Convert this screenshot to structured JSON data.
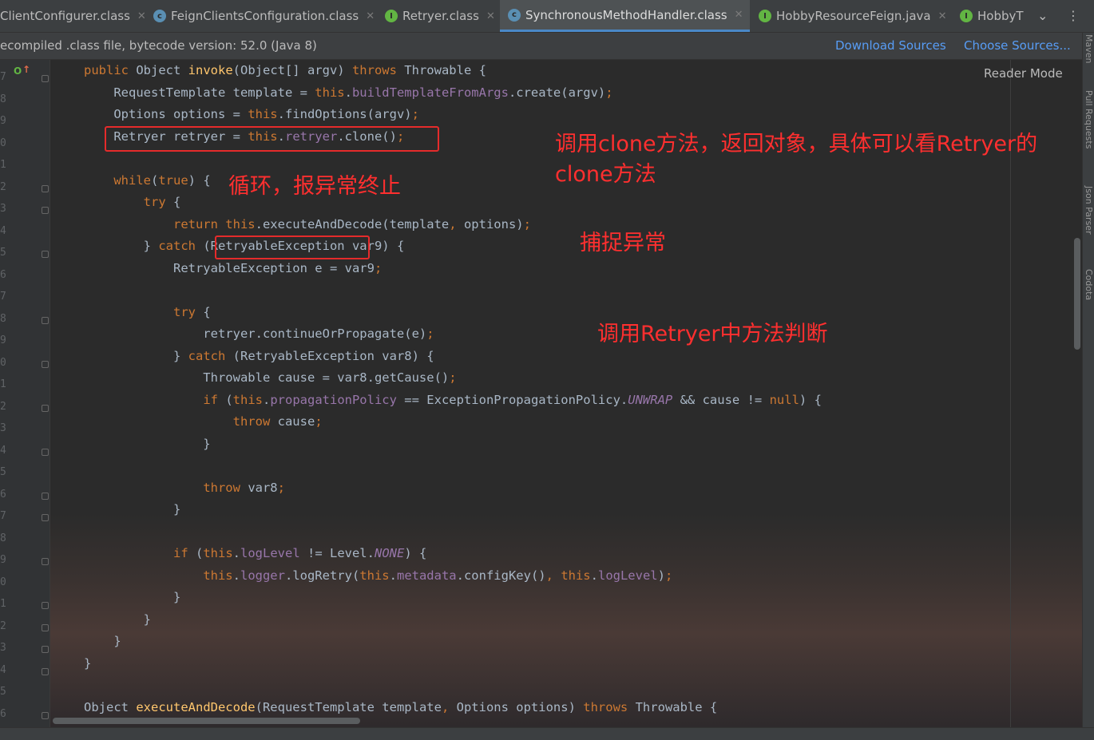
{
  "tabs": [
    {
      "label": "ClientConfigurer.class",
      "icon": "class-icon"
    },
    {
      "label": "FeignClientsConfiguration.class",
      "icon": "class-icon"
    },
    {
      "label": "Retryer.class",
      "icon": "interface-icon"
    },
    {
      "label": "SynchronousMethodHandler.class",
      "icon": "class-icon",
      "active": true
    },
    {
      "label": "HobbyResourceFeign.java",
      "icon": "interface-icon"
    },
    {
      "label": "HobbyT",
      "icon": "interface-icon"
    }
  ],
  "banner": {
    "message": "ecompiled .class file, bytecode version: 52.0 (Java 8)",
    "download_sources": "Download Sources",
    "choose_sources": "Choose Sources..."
  },
  "reader_mode": "Reader Mode",
  "right_strip": [
    "Maven",
    "Pull Requests",
    "Json Parser",
    "Codota"
  ],
  "line_numbers": [
    "7",
    "8",
    "9",
    "0",
    "1",
    "2",
    "3",
    "4",
    "5",
    "6",
    "7",
    "8",
    "9",
    "0",
    "1",
    "2",
    "3",
    "4",
    "5",
    "6",
    "7",
    "8",
    "9",
    "0",
    "1",
    "2",
    "3",
    "4",
    "5",
    "6"
  ],
  "code_lines": [
    "<span class=\"kw\">public</span> Object <span class=\"fn\">invoke</span>(Object[] argv) <span class=\"kw\">throws</span> Throwable {",
    "    RequestTemplate template = <span class=\"kw\">this</span>.<span class=\"fld\">buildTemplateFromArgs</span>.create(argv)<span class=\"kw\">;</span>",
    "    Options options = <span class=\"kw\">this</span>.findOptions(argv)<span class=\"kw\">;</span>",
    "    Retryer retryer = <span class=\"kw\">this</span>.<span class=\"fld\">retryer</span>.clone()<span class=\"kw\">;</span>",
    "",
    "    <span class=\"kw\">while</span>(<span class=\"kw\">true</span>) {",
    "        <span class=\"kw\">try</span> {",
    "            <span class=\"kw\">return this</span>.executeAndDecode(template<span class=\"kw\">,</span> options)<span class=\"kw\">;</span>",
    "        } <span class=\"kw\">catch</span> (RetryableException var9) {",
    "            RetryableException e = var9<span class=\"kw\">;</span>",
    "",
    "            <span class=\"kw\">try</span> {",
    "                retryer.continueOrPropagate(e)<span class=\"kw\">;</span>",
    "            } <span class=\"kw\">catch</span> (RetryableException var8) {",
    "                Throwable cause = var8.getCause()<span class=\"kw\">;</span>",
    "                <span class=\"kw\">if</span> (<span class=\"kw\">this</span>.<span class=\"fld\">propagationPolicy</span> == ExceptionPropagationPolicy.<span class=\"it\">UNWRAP</span> &amp;&amp; cause != <span class=\"kw\">null</span>) {",
    "                    <span class=\"kw\">throw</span> cause<span class=\"kw\">;</span>",
    "                }",
    "",
    "                <span class=\"kw\">throw</span> var8<span class=\"kw\">;</span>",
    "            }",
    "",
    "            <span class=\"kw\">if</span> (<span class=\"kw\">this</span>.<span class=\"fld\">logLevel</span> != Level.<span class=\"it\">NONE</span>) {",
    "                <span class=\"kw\">this</span>.<span class=\"fld\">logger</span>.logRetry(<span class=\"kw\">this</span>.<span class=\"fld\">metadata</span>.configKey()<span class=\"kw\">,</span> <span class=\"kw\">this</span>.<span class=\"fld\">logLevel</span>)<span class=\"kw\">;</span>",
    "            }",
    "        }",
    "    }",
    "}",
    "",
    "Object <span class=\"fn\">executeAndDecode</span>(RequestTemplate template<span class=\"kw\">,</span> Options options) <span class=\"kw\">throws</span> Throwable {"
  ],
  "annotations": {
    "clone_line1": "调用clone方法，返回对象，具体可以看Retryer的",
    "clone_line2": "clone方法",
    "loop": "循环，报异常终止",
    "catch": "捕捉异常",
    "judge": "调用Retryer中方法判断"
  },
  "colors": {
    "annotation": "#ff2f2f",
    "keyword": "#cc7832",
    "method": "#ffc66d",
    "field": "#9876aa",
    "link": "#589df6"
  }
}
